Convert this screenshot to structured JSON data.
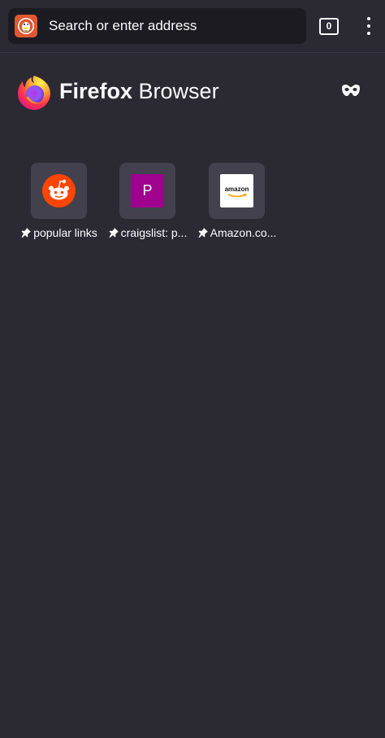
{
  "toolbar": {
    "search_placeholder": "Search or enter address",
    "search_engine_icon": "duckduckgo-icon",
    "tab_count": "0",
    "menu_icon": "kebab-menu-icon"
  },
  "home": {
    "brand_bold": "Firefox",
    "brand_light": " Browser",
    "logo_icon": "firefox-logo-icon",
    "private_mode_icon": "private-mask-icon"
  },
  "top_sites": [
    {
      "label": "popular links",
      "icon": "reddit-icon"
    },
    {
      "label": "craigslist: p...",
      "icon": "letter-tile-icon",
      "letter": "P"
    },
    {
      "label": "Amazon.co...",
      "icon": "amazon-icon",
      "logo_text": "amazon"
    }
  ],
  "colors": {
    "background": "#2b2a33",
    "url_field": "#1c1b22",
    "tile": "#42414d",
    "reddit": "#ff4500",
    "craigslist_tile": "#a0018f",
    "duckduckgo": "#de5833",
    "amazon_smile": "#ff9900"
  }
}
